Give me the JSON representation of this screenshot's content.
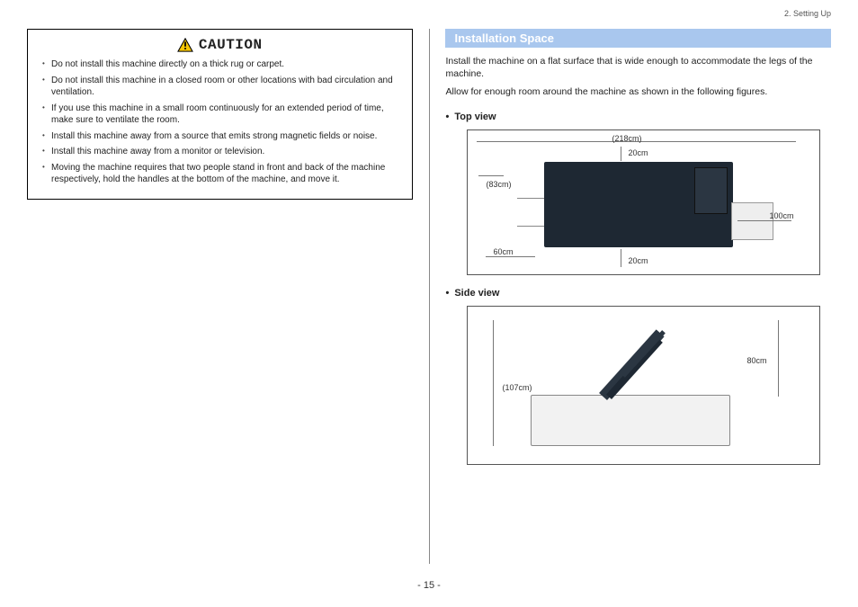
{
  "header": {
    "chapter": "2. Setting Up"
  },
  "caution": {
    "title": "CAUTION",
    "items": [
      "Do not install this machine directly on a thick rug or carpet.",
      "Do not install this machine in a closed room or other locations with bad circulation and ventilation.",
      "If you use this machine in a small room continuously for an extended period of time, make sure to ventilate the room.",
      "Install this machine away from a source that emits strong magnetic fields or noise.",
      "Install this machine away from a monitor or television.",
      "Moving the machine requires that two people stand in front and back of the machine respectively, hold the handles at the bottom of the machine, and move it."
    ]
  },
  "installation": {
    "title": "Installation Space",
    "intro1": "Install the machine on a flat surface that is wide enough to accommodate the legs of the machine.",
    "intro2": "Allow for enough room around the machine as shown in the following figures.",
    "topview_label": "Top view",
    "sideview_label": "Side view",
    "top_dims": {
      "width_total": "(218cm)",
      "left": "60cm",
      "right": "100cm",
      "depth_machine": "(83cm)",
      "front": "20cm",
      "back": "20cm"
    },
    "side_dims": {
      "height_machine": "(107cm)",
      "clearance_above": "80cm"
    }
  },
  "page_number": "- 15 -"
}
